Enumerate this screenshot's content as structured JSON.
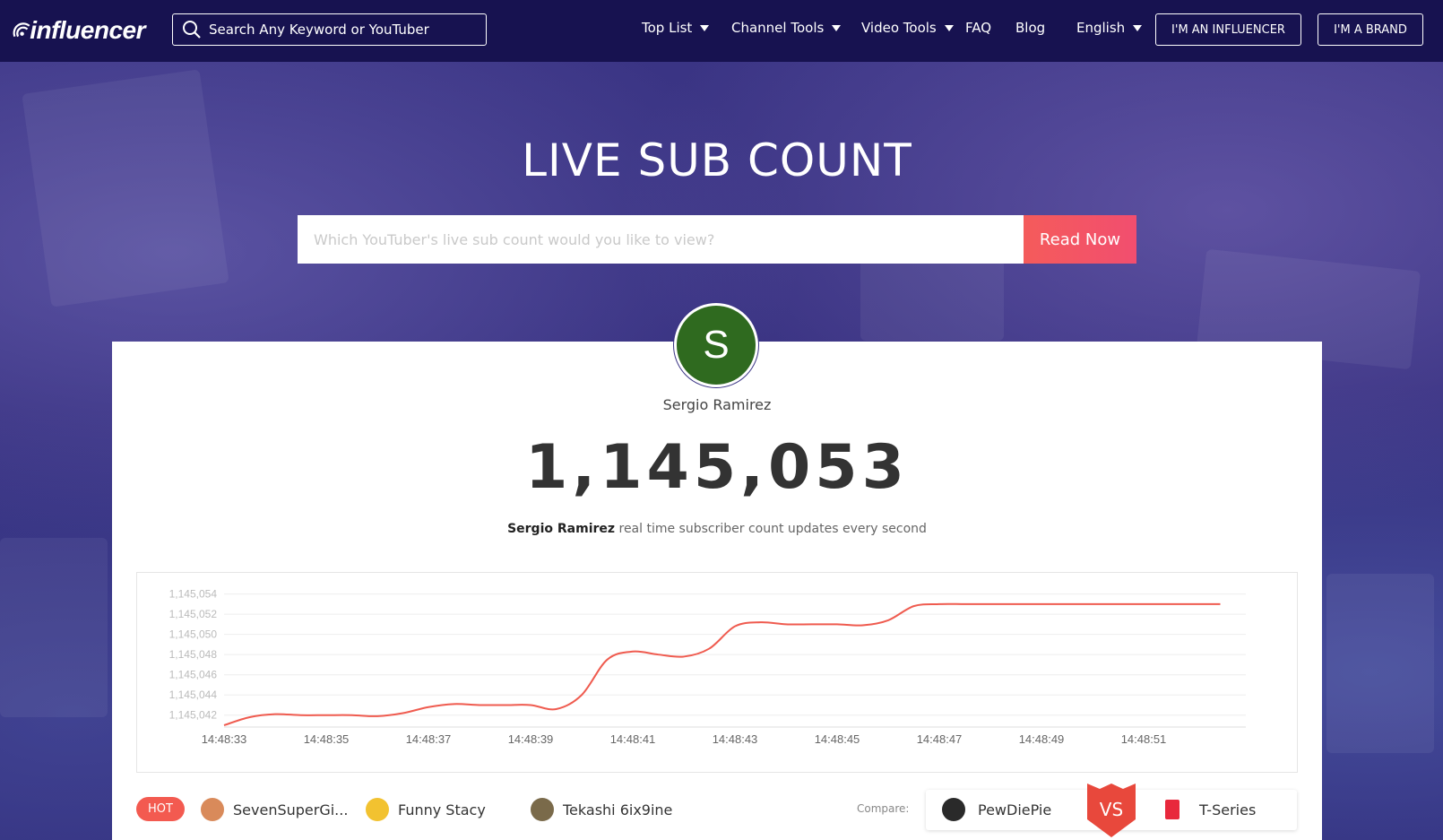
{
  "brand": {
    "logo_text": "influencer"
  },
  "nav": {
    "search_placeholder": "Search Any Keyword or YouTuber",
    "items": [
      {
        "label": "Top List",
        "dropdown": true
      },
      {
        "label": "Channel Tools",
        "dropdown": true
      },
      {
        "label": "Video Tools",
        "dropdown": true
      },
      {
        "label": "FAQ",
        "dropdown": false
      },
      {
        "label": "Blog",
        "dropdown": false
      },
      {
        "label": "English",
        "dropdown": true
      }
    ],
    "influencer_button": "I'M AN INFLUENCER",
    "brand_button": "I'M A BRAND"
  },
  "hero": {
    "title": "LIVE SUB COUNT",
    "search_placeholder": "Which YouTuber's live sub count would you like to view?",
    "search_button": "Read Now"
  },
  "channel": {
    "avatar_letter": "S",
    "avatar_color": "#2f6a1f",
    "name": "Sergio Ramirez",
    "sub_count": "1,145,053",
    "desc_name": "Sergio Ramirez",
    "desc_text": " real time subscriber count updates every second"
  },
  "chart_data": {
    "type": "line",
    "color": "#ef5b4f",
    "y_ticks": [
      "1,145,042",
      "1,145,044",
      "1,145,046",
      "1,145,048",
      "1,145,050",
      "1,145,052",
      "1,145,054"
    ],
    "ylim": [
      1145041,
      1145054.5
    ],
    "x_ticks": [
      "14:48:33",
      "14:48:35",
      "14:48:37",
      "14:48:39",
      "14:48:41",
      "14:48:43",
      "14:48:45",
      "14:48:47",
      "14:48:49",
      "14:48:51"
    ],
    "x_seconds": [
      33,
      33.5,
      34,
      34.5,
      35,
      35.5,
      36,
      36.5,
      37,
      37.5,
      38,
      38.5,
      39,
      39.5,
      40,
      40.5,
      41,
      41.5,
      42,
      42.5,
      43,
      43.5,
      44,
      44.5,
      45,
      45.5,
      46,
      46.5,
      47,
      47.5,
      48,
      48.5,
      49,
      49.5,
      50,
      50.5,
      51,
      51.5,
      52,
      52.5
    ],
    "values": [
      1145041,
      1145041.8,
      1145042.1,
      1145042,
      1145042,
      1145042,
      1145041.9,
      1145042.2,
      1145042.8,
      1145043.1,
      1145043,
      1145043,
      1145043,
      1145042.6,
      1145044,
      1145047.5,
      1145048.3,
      1145048,
      1145047.8,
      1145048.6,
      1145050.8,
      1145051.2,
      1145051,
      1145051,
      1145051,
      1145050.9,
      1145051.4,
      1145052.8,
      1145053,
      1145053,
      1145053,
      1145053,
      1145053,
      1145053,
      1145053,
      1145053,
      1145053,
      1145053,
      1145053,
      1145053
    ]
  },
  "hot": {
    "badge": "HOT",
    "items": [
      {
        "label": "SevenSuperGi...",
        "avatar_color": "#d98a5a"
      },
      {
        "label": "Funny Stacy",
        "avatar_color": "#f2c230"
      },
      {
        "label": "Tekashi 6ix9ine",
        "avatar_color": "#7a6a4a"
      }
    ]
  },
  "compare": {
    "label": "Compare:",
    "left": {
      "label": "PewDiePie",
      "avatar_color": "#2a2a2a"
    },
    "vs": "VS",
    "right": {
      "label": "T-Series",
      "avatar_color": "#e8283c"
    }
  }
}
